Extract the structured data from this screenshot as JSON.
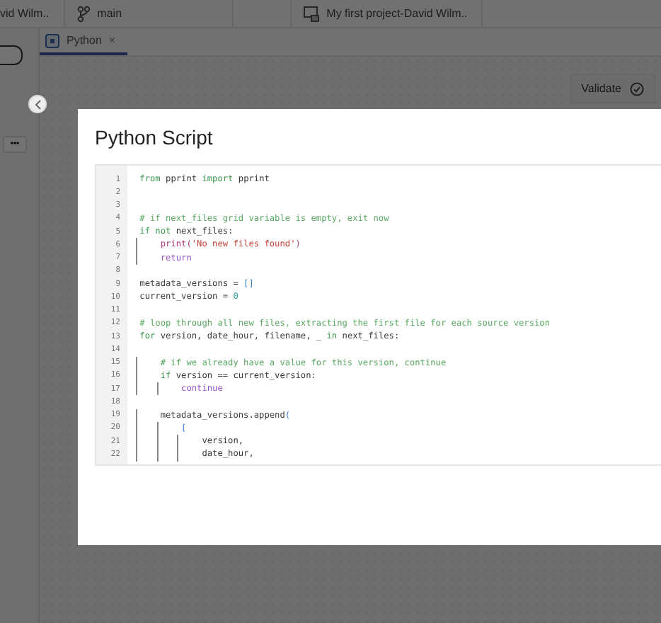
{
  "top_bar": {
    "tabs": [
      {
        "label": "vid Wilm..",
        "kind": "user"
      },
      {
        "label": "main",
        "kind": "branch"
      },
      {
        "label": "My first project-David Wilm..",
        "kind": "project"
      }
    ]
  },
  "editor_tabs": [
    {
      "label": "Python",
      "close": "×",
      "selected": true
    }
  ],
  "toolbar": {
    "validate": "Validate"
  },
  "side_panel": {
    "more": "•••"
  },
  "modal": {
    "title": "Python Script",
    "code": [
      {
        "number": "1",
        "tokens": [
          {
            "kind": "keyword",
            "text": "from"
          },
          {
            "kind": "plain",
            "text": " pprint "
          },
          {
            "kind": "keyword",
            "text": "import"
          },
          {
            "kind": "plain",
            "text": " pprint"
          }
        ]
      },
      {
        "number": "2"
      },
      {
        "number": "3"
      },
      {
        "number": "4",
        "tokens": [
          {
            "kind": "comment",
            "text": "# if next_files grid variable is empty, exit now"
          }
        ]
      },
      {
        "number": "5",
        "tokens": [
          {
            "kind": "keyword",
            "text": "if not"
          },
          {
            "kind": "plain",
            "text": " next_files:"
          }
        ]
      },
      {
        "number": "6",
        "tokens": [
          {
            "kind": "builtin",
            "text": "    print("
          },
          {
            "kind": "string",
            "text": "'No new files found'"
          },
          {
            "kind": "builtin",
            "text": ")"
          }
        ]
      },
      {
        "number": "7",
        "tokens": [
          {
            "kind": "control",
            "text": "    return"
          }
        ]
      },
      {
        "number": "8"
      },
      {
        "number": "9",
        "tokens": [
          {
            "kind": "plain",
            "text": "metadata_versions = "
          },
          {
            "kind": "bracket",
            "text": "[]"
          }
        ]
      },
      {
        "number": "10",
        "tokens": [
          {
            "kind": "plain",
            "text": "current_version = "
          },
          {
            "kind": "number",
            "text": "0"
          }
        ]
      },
      {
        "number": "11"
      },
      {
        "number": "12",
        "tokens": [
          {
            "kind": "comment",
            "text": "# loop through all new files, extracting the first file for each source version"
          }
        ]
      },
      {
        "number": "13",
        "tokens": [
          {
            "kind": "keyword",
            "text": "for"
          },
          {
            "kind": "plain",
            "text": " version, date_hour, filename, _ "
          },
          {
            "kind": "keyword",
            "text": "in"
          },
          {
            "kind": "plain",
            "text": " next_files:"
          }
        ]
      },
      {
        "number": "14"
      },
      {
        "number": "15",
        "tokens": [
          {
            "kind": "comment",
            "text": "    # if we already have a value for this version, continue"
          }
        ]
      },
      {
        "number": "16",
        "tokens": [
          {
            "kind": "keyword",
            "text": "    if"
          },
          {
            "kind": "plain",
            "text": " version == current_version:"
          }
        ]
      },
      {
        "number": "17",
        "tokens": [
          {
            "kind": "control",
            "text": "        continue"
          }
        ]
      },
      {
        "number": "18"
      },
      {
        "number": "19",
        "tokens": [
          {
            "kind": "plain",
            "text": "    metadata_versions.append"
          },
          {
            "kind": "bracket",
            "text": "("
          }
        ]
      },
      {
        "number": "20",
        "tokens": [
          {
            "kind": "bracket",
            "text": "        ["
          }
        ]
      },
      {
        "number": "21",
        "tokens": [
          {
            "kind": "plain",
            "text": "            version,"
          }
        ]
      },
      {
        "number": "22",
        "tokens": [
          {
            "kind": "plain",
            "text": "            date_hour,"
          }
        ]
      }
    ]
  }
}
